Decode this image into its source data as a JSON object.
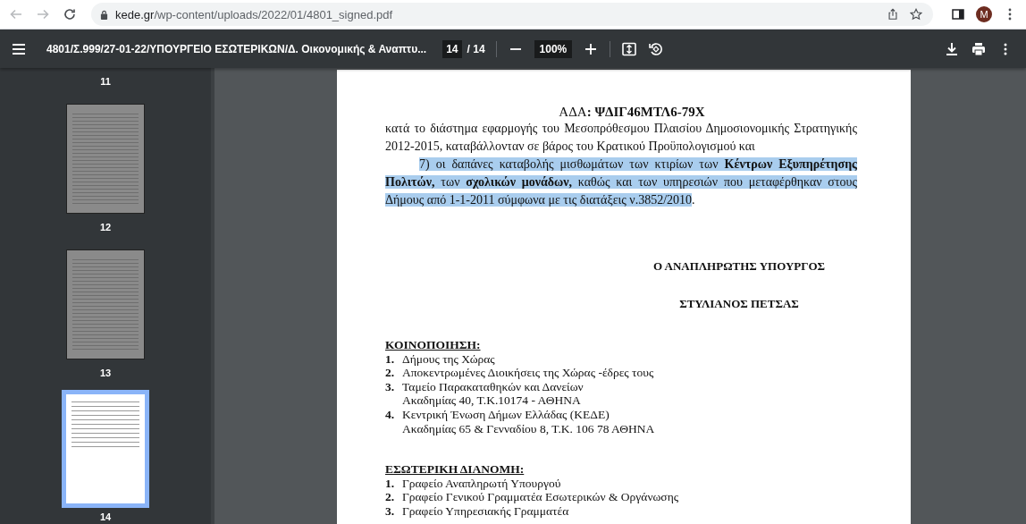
{
  "browser": {
    "url_host": "kede.gr",
    "url_path": "/wp-content/uploads/2022/01/4801_signed.pdf",
    "avatar_letter": "M"
  },
  "toolbar": {
    "title": "4801/Σ.999/27-01-22/ΥΠΟΥΡΓΕΙΟ ΕΣΩΤΕΡΙΚΩΝ/Δ. Οικονομικής & Αναπτυ...",
    "page_input": "14",
    "page_total": "/ 14",
    "zoom": "100%"
  },
  "thumbnails": [
    {
      "label": "11",
      "selected": false
    },
    {
      "label": "12",
      "selected": false
    },
    {
      "label": "13",
      "selected": false
    },
    {
      "label": "14",
      "selected": true
    }
  ],
  "document": {
    "ada": "ΑΔΑ**: ΨΔΙΓ46ΜΤΛ6-79Χ**",
    "paragraphs": [
      {
        "text": "κατά το διάστημα εφαρμογής του Μεσοπρόθεσμου Πλαισίου Δημοσιονομικής Στρατηγικής 2012-2015, καταβάλλονταν σε βάρος του Κρατικού Προϋπολογισμού και",
        "indent": false,
        "selected": false
      },
      {
        "text": "7) οι δαπάνες καταβολής μισθωμάτων των κτιρίων των **Κέντρων Εξυπηρέτησης Πολιτών,** των **σχολικών μονάδων,** καθώς και των υπηρεσιών που μεταφέρθηκαν στους Δήμους από 1-1-2011 σύμφωνα με τις διατάξεις ν.3852/2010",
        "indent": true,
        "selected": true
      }
    ],
    "closing": ".",
    "signature": {
      "title": "Ο ΑΝΑΠΛΗΡΩΤΗΣ ΥΠΟΥΡΓΟΣ",
      "name": "ΣΤΥΛΙΑΝΟΣ ΠΕΤΣΑΣ"
    },
    "distribution": [
      {
        "heading": "ΚΟΙΝΟΠΟΙΗΣΗ:",
        "items": [
          {
            "number": "1.",
            "lines": [
              "Δήμους της Χώρας"
            ]
          },
          {
            "number": "2.",
            "lines": [
              "Αποκεντρωμένες Διοικήσεις της Χώρας -έδρες τους"
            ]
          },
          {
            "number": "3.",
            "lines": [
              "Ταμείο Παρακαταθηκών και Δανείων",
              "Ακαδημίας 40, Τ.Κ.10174 - ΑΘΗΝΑ"
            ]
          },
          {
            "number": "4.",
            "lines": [
              "Κεντρική Ένωση Δήμων Ελλάδας (ΚΕΔΕ)",
              "Ακαδημίας 65 & Γενναδίου 8,  Τ.Κ. 106 78 ΑΘΗΝΑ"
            ]
          }
        ]
      },
      {
        "heading": "ΕΣΩΤΕΡΙΚΗ ΔΙΑΝΟΜΗ:",
        "items": [
          {
            "number": "1.",
            "lines": [
              "Γραφείο Αναπληρωτή Υπουργού"
            ]
          },
          {
            "number": "2.",
            "lines": [
              "Γραφείο Γενικού Γραμματέα Εσωτερικών & Οργάνωσης"
            ]
          },
          {
            "number": "3.",
            "lines": [
              "Γραφείο Υπηρεσιακής Γραμματέα"
            ]
          }
        ]
      }
    ]
  }
}
